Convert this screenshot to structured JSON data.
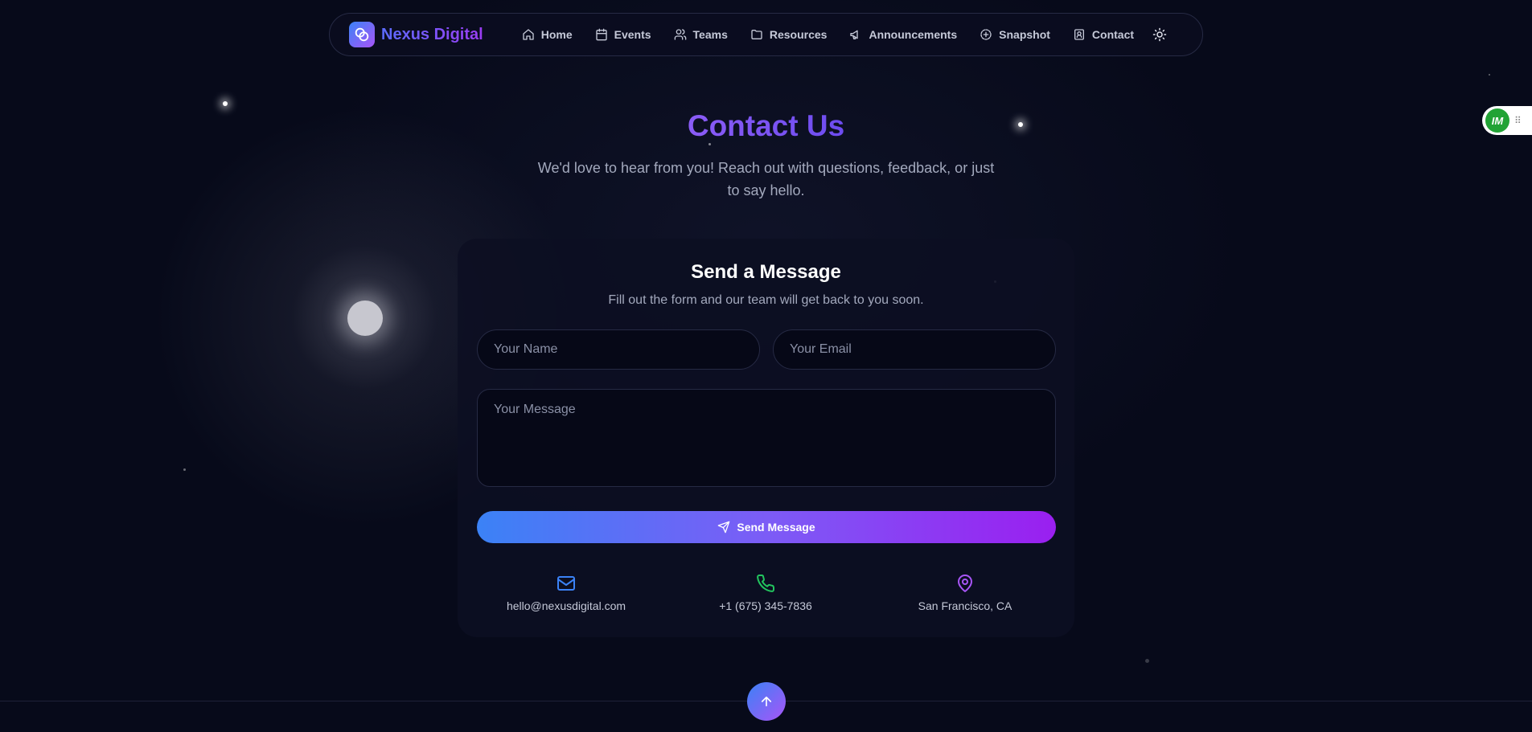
{
  "brand": {
    "name": "Nexus Digital",
    "logo_icon": "rings-icon"
  },
  "nav": {
    "items": [
      {
        "label": "Home",
        "icon": "home-icon"
      },
      {
        "label": "Events",
        "icon": "calendar-icon"
      },
      {
        "label": "Teams",
        "icon": "users-icon"
      },
      {
        "label": "Resources",
        "icon": "folder-icon"
      },
      {
        "label": "Announcements",
        "icon": "megaphone-icon"
      },
      {
        "label": "Snapshot",
        "icon": "snapshot-icon"
      },
      {
        "label": "Contact",
        "icon": "contact-icon"
      }
    ],
    "theme_toggle_icon": "sun-icon"
  },
  "extension": {
    "label": "IM"
  },
  "hero": {
    "title": "Contact Us",
    "subtitle": "We'd love to hear from you! Reach out with questions, feedback, or just to say hello."
  },
  "form": {
    "title": "Send a Message",
    "subtitle": "Fill out the form and our team will get back to you soon.",
    "name_placeholder": "Your Name",
    "email_placeholder": "Your Email",
    "message_placeholder": "Your Message",
    "submit_label": "Send Message"
  },
  "contact_info": [
    {
      "icon": "mail-icon",
      "text": "hello@nexusdigital.com",
      "color": "#3b82f6"
    },
    {
      "icon": "phone-icon",
      "text": "+1 (675) 345-7836",
      "color": "#22c55e"
    },
    {
      "icon": "map-pin-icon",
      "text": "San Francisco, CA",
      "color": "#a855f7"
    }
  ],
  "colors": {
    "background": "#070a1a",
    "accent_start": "#3b82f6",
    "accent_end": "#9a1ff0"
  }
}
